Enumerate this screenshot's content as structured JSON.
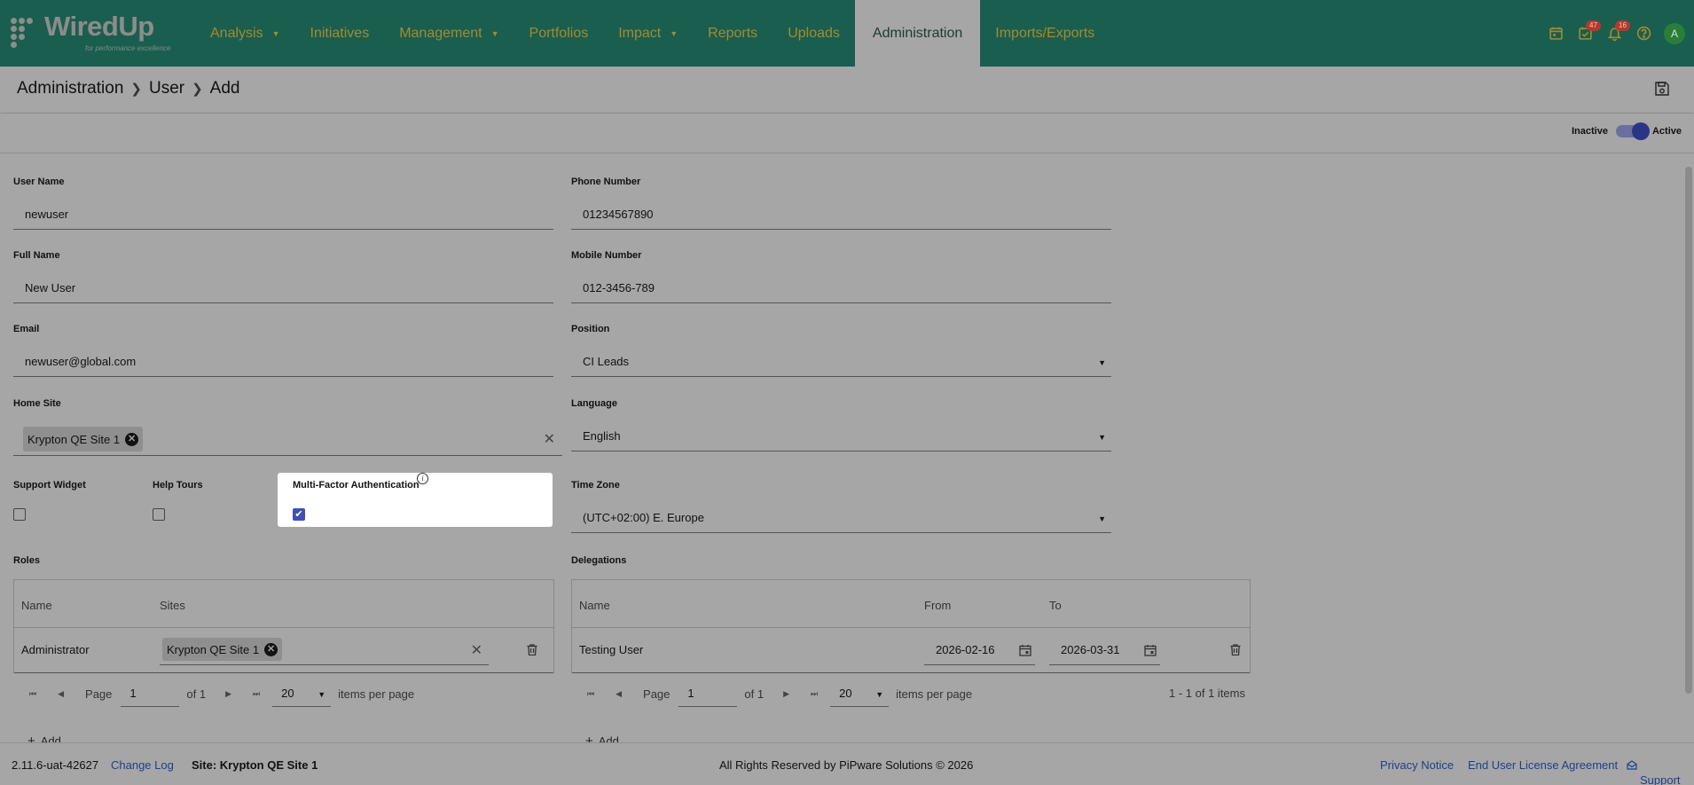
{
  "app": {
    "logo_text": "WiredUp",
    "logo_tagline": "for performance excellence"
  },
  "nav": {
    "items": [
      {
        "label": "Analysis",
        "dropdown": true
      },
      {
        "label": "Initiatives",
        "dropdown": false
      },
      {
        "label": "Management",
        "dropdown": true
      },
      {
        "label": "Portfolios",
        "dropdown": false
      },
      {
        "label": "Impact",
        "dropdown": true
      },
      {
        "label": "Reports",
        "dropdown": false
      },
      {
        "label": "Uploads",
        "dropdown": false
      },
      {
        "label": "Administration",
        "dropdown": false,
        "active": true
      },
      {
        "label": "Imports/Exports",
        "dropdown": false
      }
    ],
    "tasks_badge": "47",
    "notifications_badge": "16",
    "avatar_initial": "A"
  },
  "breadcrumb": [
    "Administration",
    "User",
    "Add"
  ],
  "status_toggle": {
    "off_label": "Inactive",
    "on_label": "Active",
    "value": "Active"
  },
  "form": {
    "user_name": {
      "label": "User Name",
      "value": "newuser"
    },
    "full_name": {
      "label": "Full Name",
      "value": "New User"
    },
    "email": {
      "label": "Email",
      "value": "newuser@global.com"
    },
    "home_site": {
      "label": "Home Site",
      "chip": "Krypton QE Site 1"
    },
    "support_widget": {
      "label": "Support Widget",
      "checked": false
    },
    "help_tours": {
      "label": "Help Tours",
      "checked": false
    },
    "mfa": {
      "label": "Multi-Factor Authentication",
      "checked": true
    },
    "phone_number": {
      "label": "Phone Number",
      "value": "01234567890"
    },
    "mobile_number": {
      "label": "Mobile Number",
      "value": "012-3456-789"
    },
    "position": {
      "label": "Position",
      "value": "CI Leads"
    },
    "language": {
      "label": "Language",
      "value": "English"
    },
    "time_zone": {
      "label": "Time Zone",
      "value": "(UTC+02:00) E. Europe"
    }
  },
  "roles": {
    "title": "Roles",
    "columns": [
      "Name",
      "Sites"
    ],
    "rows": [
      {
        "name": "Administrator",
        "site_chip": "Krypton QE Site 1"
      }
    ],
    "pager": {
      "page_label": "Page",
      "page": "1",
      "of": "of 1",
      "per_page": "20",
      "per_page_label": "items per page"
    },
    "add_label": "Add"
  },
  "delegations": {
    "title": "Delegations",
    "columns": [
      "Name",
      "From",
      "To"
    ],
    "rows": [
      {
        "name": "Testing User",
        "from": "2026-02-16",
        "to": "2026-03-31"
      }
    ],
    "pager": {
      "page_label": "Page",
      "page": "1",
      "of": "of 1",
      "per_page": "20",
      "per_page_label": "items per page",
      "summary": "1 - 1 of 1 items"
    },
    "add_label": "Add"
  },
  "footer": {
    "version": "2.11.6-uat-42627",
    "change_log": "Change Log",
    "site": "Site: Krypton QE Site 1",
    "copyright": "All Rights Reserved by PiPware Solutions © 2026",
    "privacy": "Privacy Notice",
    "eula": "End User License Agreement",
    "support": "Support"
  }
}
